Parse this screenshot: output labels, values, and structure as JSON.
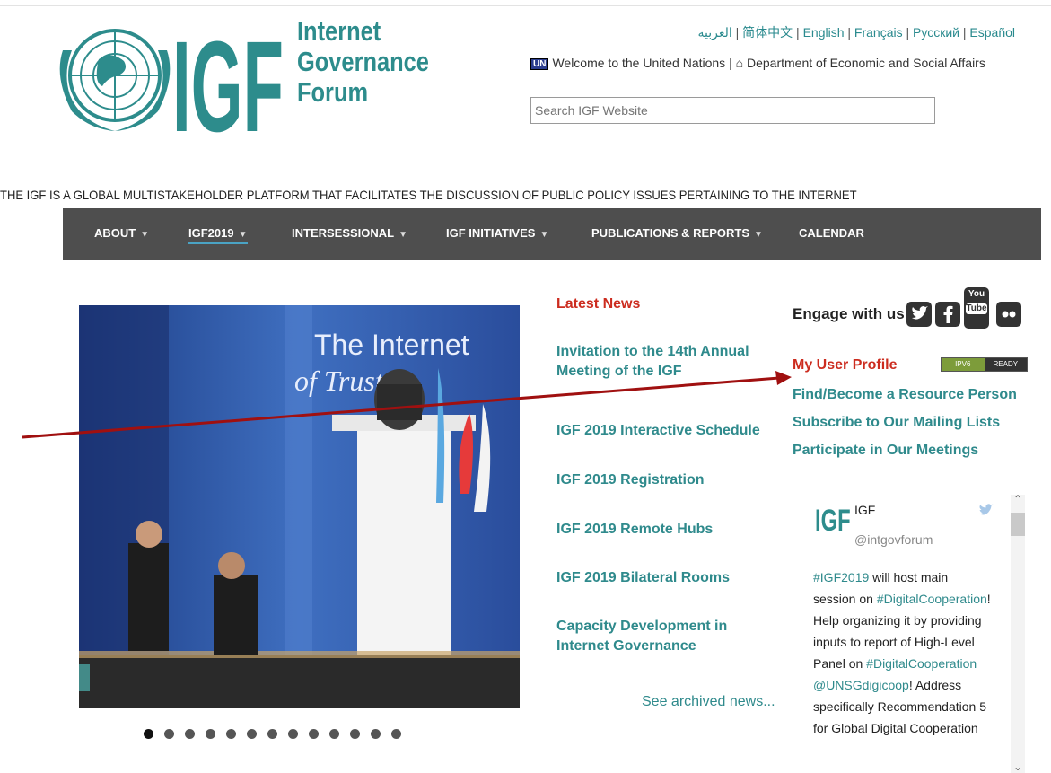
{
  "header": {
    "logo_lines": [
      "Internet",
      "Governance",
      "Forum"
    ],
    "logo_big": "IGF",
    "languages": [
      "العربية",
      "简体中文",
      "English",
      "Français",
      "Русский",
      "Español"
    ],
    "un_badge": "UN",
    "welcome_text": "Welcome to the United Nations",
    "home_icon": "home-icon",
    "desa_text": "Department of Economic and Social Affairs",
    "search_placeholder": "Search IGF Website"
  },
  "tagline": "THE IGF IS A GLOBAL MULTISTAKEHOLDER PLATFORM THAT FACILITATES THE DISCUSSION OF PUBLIC POLICY ISSUES PERTAINING TO THE INTERNET",
  "nav": {
    "items": [
      {
        "label": "ABOUT",
        "caret": "▼"
      },
      {
        "label": "IGF2019",
        "caret": "▼"
      },
      {
        "label": "INTERSESSIONAL",
        "caret": "▼"
      },
      {
        "label": "IGF INITIATIVES",
        "caret": "▼"
      },
      {
        "label": "PUBLICATIONS & REPORTS",
        "caret": "▼"
      },
      {
        "label": "CALENDAR",
        "caret": ""
      }
    ],
    "active_index": 1
  },
  "hero": {
    "banner_line1": "The Internet",
    "banner_line2": "of Trust",
    "slide_count": 13,
    "active_slide": 0
  },
  "news": {
    "heading": "Latest News",
    "items": [
      "Invitation to the 14th Annual Meeting of the IGF",
      "IGF 2019 Interactive Schedule",
      "IGF 2019 Registration",
      "IGF 2019 Remote Hubs",
      "IGF 2019 Bilateral Rooms",
      "Capacity Development in Internet Governance"
    ],
    "archived": "See archived news..."
  },
  "sidebar": {
    "engage": "Engage with us:",
    "social": [
      "twitter-icon",
      "facebook-icon",
      "youtube-icon",
      "flickr-icon"
    ],
    "profile": "My User Profile",
    "ipv6": [
      "IPV6",
      "READY"
    ],
    "links": [
      "Find/Become a Resource Person",
      "Subscribe to Our Mailing Lists",
      "Participate in Our Meetings"
    ]
  },
  "tweet": {
    "logo": "IGF",
    "name": "IGF",
    "handle": "@intgovforum",
    "parts": [
      {
        "t": "#IGF2019",
        "h": true
      },
      {
        "t": " will host main session on ",
        "h": false
      },
      {
        "t": "#DigitalCooperation",
        "h": true
      },
      {
        "t": "! Help organizing it by providing inputs to report of High-Level Panel on ",
        "h": false
      },
      {
        "t": "#DigitalCooperation",
        "h": true
      },
      {
        "t": " ",
        "h": false
      },
      {
        "t": "@UNSGdigicoop",
        "h": true
      },
      {
        "t": "! Address specifically Recommendation 5 for Global Digital Cooperation",
        "h": false
      }
    ]
  },
  "colors": {
    "brand_teal": "#2d8c8c",
    "accent_red": "#cc2c1f",
    "nav_bg": "#4e4e4e",
    "arrow": "#a01010"
  }
}
